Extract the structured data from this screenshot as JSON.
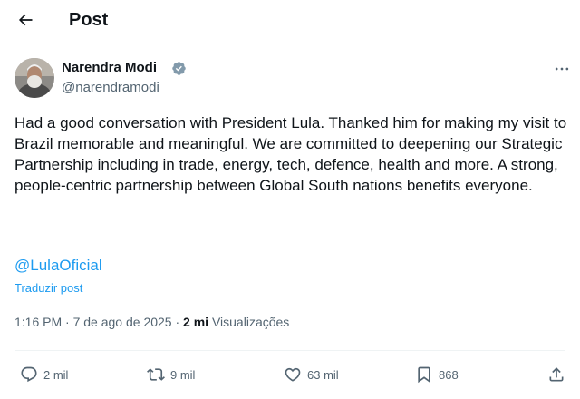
{
  "header": {
    "title": "Post"
  },
  "author": {
    "name": "Narendra Modi",
    "handle": "@narendramodi"
  },
  "post": {
    "text": "Had a good conversation with President Lula. Thanked him for making my visit to Brazil memorable and meaningful. We are committed to deepening our Strategic Partnership including in trade, energy, tech, defence, health and more. A strong, people-centric partnership between Global South nations benefits everyone.",
    "mention": "@LulaOficial",
    "translate_label": "Traduzir post"
  },
  "meta": {
    "time": "1:16 PM",
    "separator": "·",
    "date": "7 de ago de 2025",
    "views_count": "2 mi",
    "views_label": "Visualizações"
  },
  "actions": {
    "replies": "2 mil",
    "reposts": "9 mil",
    "likes": "63 mil",
    "bookmarks": "868"
  },
  "colors": {
    "link": "#1d9bf0",
    "secondary_text": "#536471",
    "primary_text": "#0f1419",
    "divider": "#eff3f4"
  }
}
